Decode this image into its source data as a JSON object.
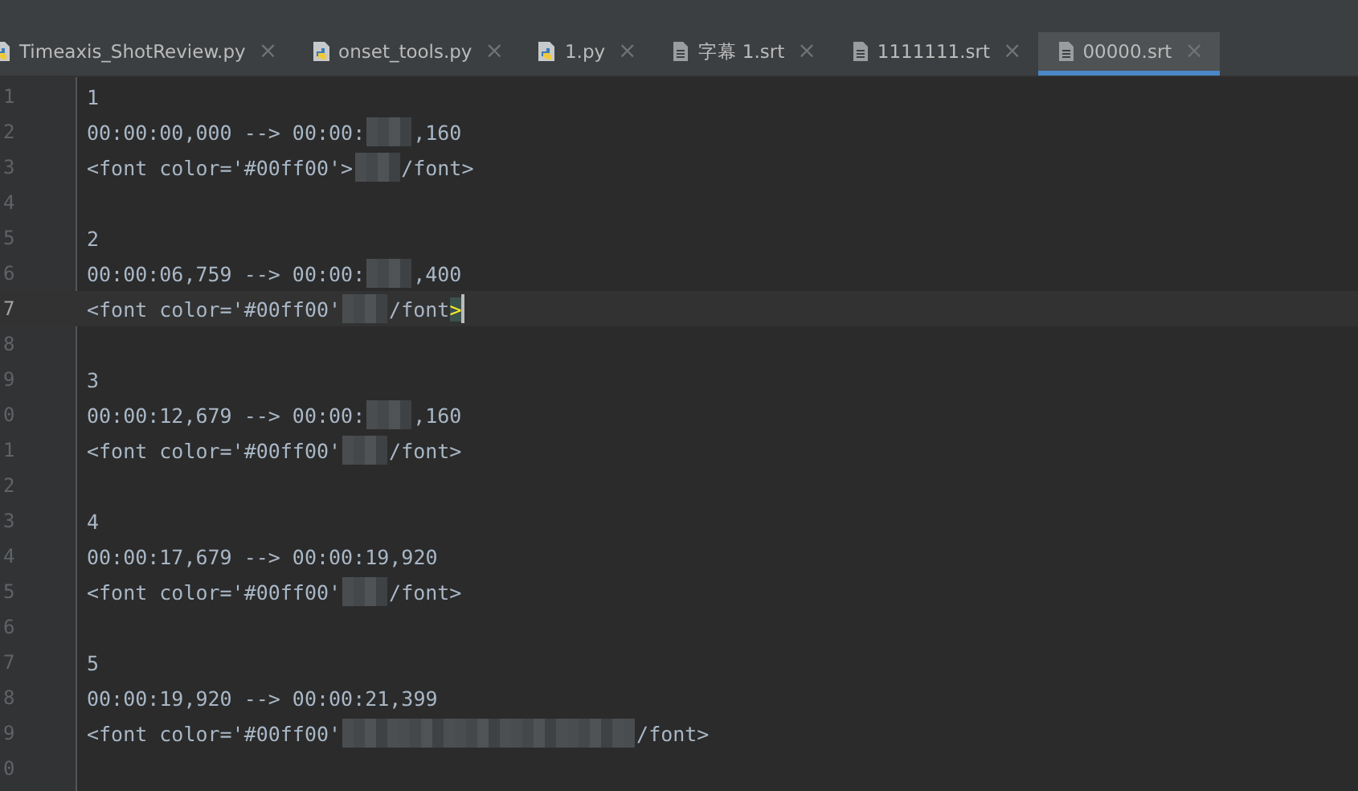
{
  "tabs": [
    {
      "label": "Timeaxis_ShotReview.py",
      "kind": "python",
      "selected": false
    },
    {
      "label": "onset_tools.py",
      "kind": "python",
      "selected": false
    },
    {
      "label": "1.py",
      "kind": "python",
      "selected": false
    },
    {
      "label": "字幕 1.srt",
      "kind": "text",
      "selected": false
    },
    {
      "label": "1111111.srt",
      "kind": "text",
      "selected": false
    },
    {
      "label": "00000.srt",
      "kind": "text",
      "selected": true
    }
  ],
  "close_glyph": "×",
  "editor": {
    "lines": [
      {
        "number": "1",
        "current": false,
        "parts": [
          {
            "kind": "text",
            "text": "1"
          }
        ]
      },
      {
        "number": "2",
        "current": false,
        "parts": [
          {
            "kind": "text",
            "text": "00:00:00,000 --> 00:00:"
          },
          {
            "kind": "blur"
          },
          {
            "kind": "text",
            "text": ",160"
          }
        ]
      },
      {
        "number": "3",
        "current": false,
        "parts": [
          {
            "kind": "text",
            "text": "<font color='#00ff00'>"
          },
          {
            "kind": "blur"
          },
          {
            "kind": "text",
            "text": "/font>"
          }
        ]
      },
      {
        "number": "4",
        "current": false
      },
      {
        "number": "5",
        "current": false,
        "parts": [
          {
            "kind": "text",
            "text": "2"
          }
        ]
      },
      {
        "number": "6",
        "current": false,
        "parts": [
          {
            "kind": "text",
            "text": "00:00:06,759 --> 00:00:"
          },
          {
            "kind": "blur"
          },
          {
            "kind": "text",
            "text": ",400"
          }
        ]
      },
      {
        "number": "7",
        "current": true,
        "parts": [
          {
            "kind": "text",
            "text": "<font color='#00ff00'"
          },
          {
            "kind": "blur"
          },
          {
            "kind": "text",
            "text": "/font"
          },
          {
            "kind": "match",
            "text": ">"
          }
        ]
      },
      {
        "number": "8",
        "current": false
      },
      {
        "number": "9",
        "current": false,
        "parts": [
          {
            "kind": "text",
            "text": "3"
          }
        ]
      },
      {
        "number": "0",
        "current": false,
        "parts": [
          {
            "kind": "text",
            "text": "00:00:12,679 --> 00:00:"
          },
          {
            "kind": "blur"
          },
          {
            "kind": "text",
            "text": ",160"
          }
        ]
      },
      {
        "number": "1",
        "current": false,
        "parts": [
          {
            "kind": "text",
            "text": "<font color='#00ff00'"
          },
          {
            "kind": "blur"
          },
          {
            "kind": "text",
            "text": "/font>"
          }
        ]
      },
      {
        "number": "2",
        "current": false
      },
      {
        "number": "3",
        "current": false,
        "parts": [
          {
            "kind": "text",
            "text": "4"
          }
        ]
      },
      {
        "number": "4",
        "current": false,
        "parts": [
          {
            "kind": "text",
            "text": "00:00:17,679 --> 00:00:19,920"
          }
        ]
      },
      {
        "number": "5",
        "current": false,
        "parts": [
          {
            "kind": "text",
            "text": "<font color='#00ff00'"
          },
          {
            "kind": "blur"
          },
          {
            "kind": "text",
            "text": "/font>"
          }
        ]
      },
      {
        "number": "6",
        "current": false
      },
      {
        "number": "7",
        "current": false,
        "parts": [
          {
            "kind": "text",
            "text": "5"
          }
        ]
      },
      {
        "number": "8",
        "current": false,
        "parts": [
          {
            "kind": "text",
            "text": "00:00:19,920 --> 00:00:21,399"
          }
        ]
      },
      {
        "number": "9",
        "current": false,
        "parts": [
          {
            "kind": "text",
            "text": "<font color='#00ff00'"
          },
          {
            "kind": "wide_blur"
          },
          {
            "kind": "text",
            "text": "/font>"
          }
        ]
      },
      {
        "number": "0",
        "current": false
      }
    ]
  }
}
